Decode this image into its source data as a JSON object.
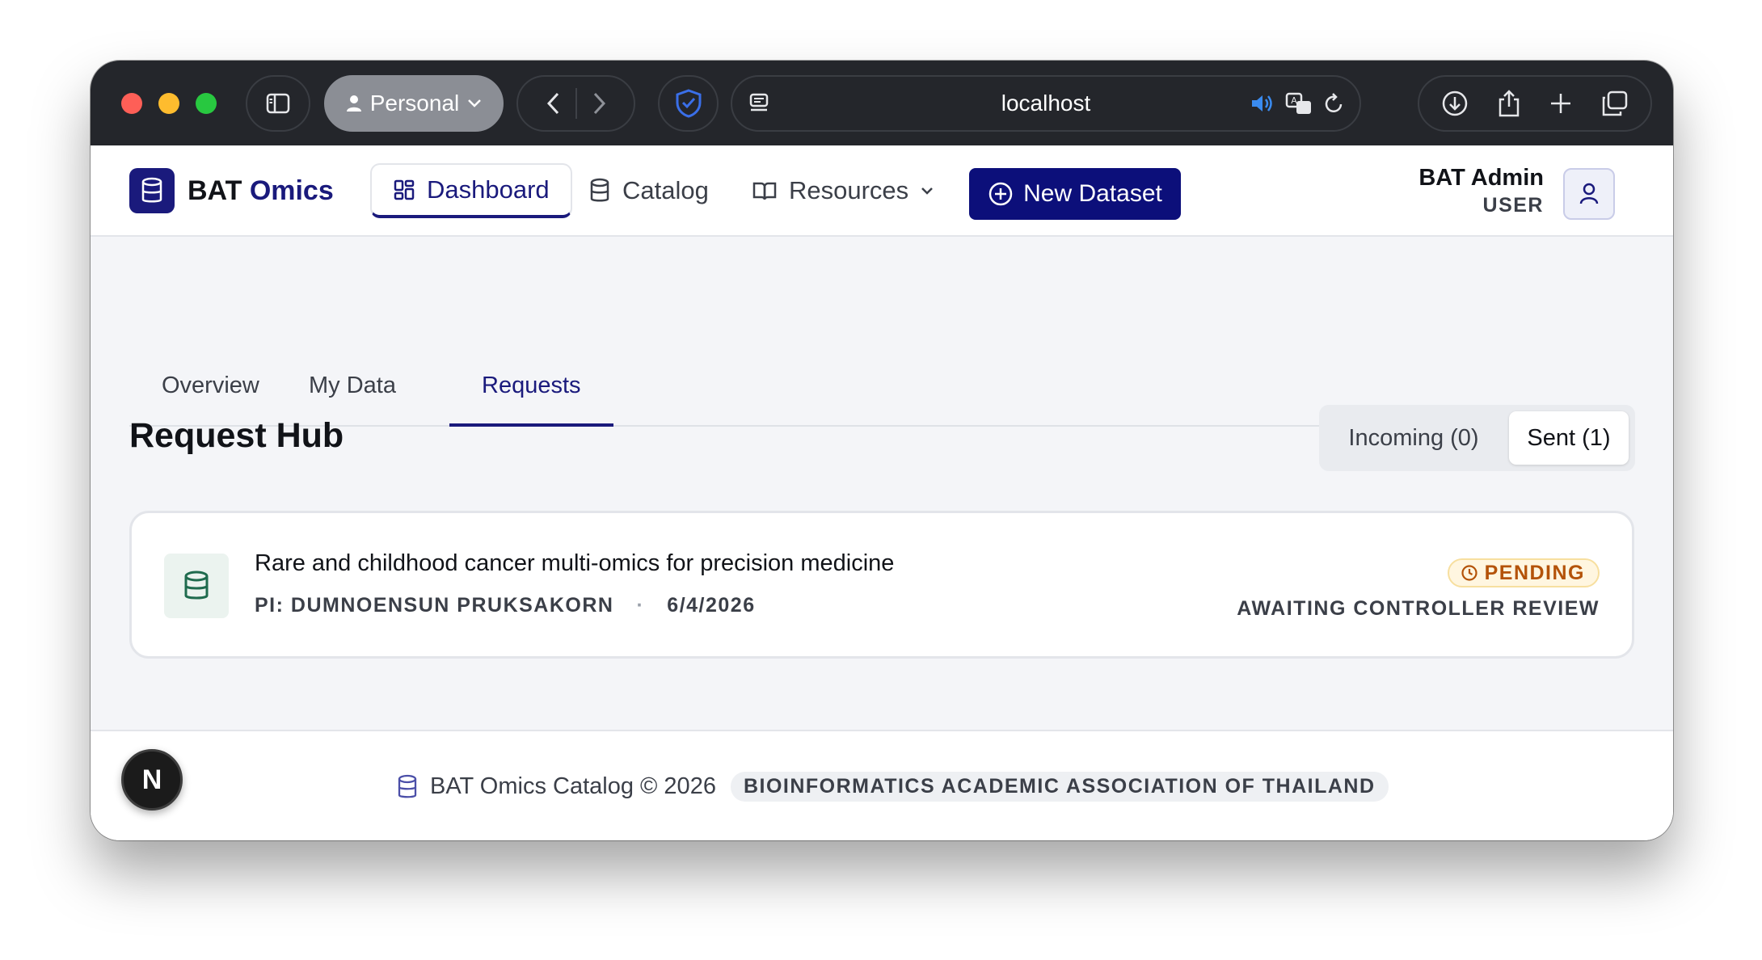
{
  "browser": {
    "profile_label": "Personal",
    "url": "localhost"
  },
  "app": {
    "brand_prefix": "BAT",
    "brand_accent": "Omics",
    "nav": {
      "dashboard": "Dashboard",
      "catalog": "Catalog",
      "resources": "Resources"
    },
    "new_dataset_label": "New Dataset",
    "user": {
      "name": "BAT Admin",
      "role": "USER"
    }
  },
  "tabs": {
    "overview": "Overview",
    "my_data": "My Data",
    "requests": "Requests"
  },
  "hub": {
    "title": "Request Hub",
    "incoming_label": "Incoming (0)",
    "sent_label": "Sent (1)",
    "requests": [
      {
        "title": "Rare and childhood cancer multi-omics for precision medicine",
        "pi": "PI: DUMNOENSUN PRUKSAKORN",
        "date": "6/4/2026",
        "status": "PENDING",
        "status_note": "AWAITING CONTROLLER REVIEW"
      }
    ]
  },
  "footer": {
    "copyright": "BAT Omics Catalog © 2026",
    "organization": "BIOINFORMATICS ACADEMIC ASSOCIATION OF THAILAND",
    "next_badge": "N"
  },
  "colors": {
    "brand": "#1a1a7c",
    "pending": "#b45309",
    "chrome": "#24262b"
  }
}
